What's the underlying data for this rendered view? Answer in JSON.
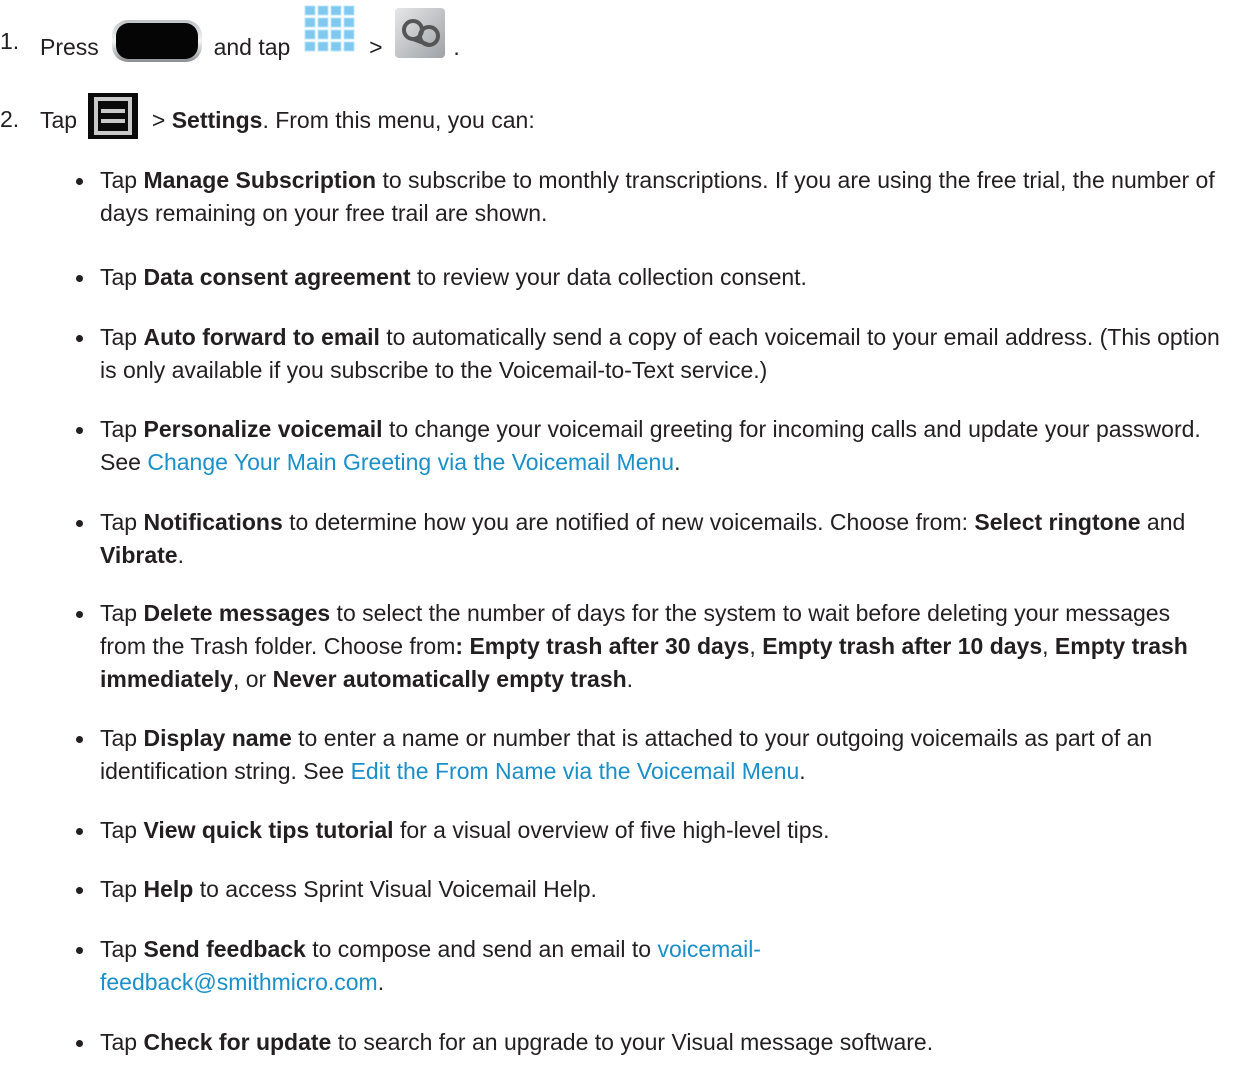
{
  "step1": {
    "number": "1.",
    "press": "Press",
    "and_tap": "and tap",
    "gt": ">",
    "period": ".",
    "icons": [
      "home-key-icon",
      "apps-grid-icon",
      "voicemail-icon"
    ]
  },
  "step2": {
    "number": "2.",
    "tap": "Tap",
    "gt": ">",
    "settings": "Settings",
    "rest": ". From this menu, you can:",
    "icons": [
      "menu-key-icon"
    ]
  },
  "bullets": [
    {
      "pre": "Tap ",
      "bold": "Manage Subscription",
      "post": " to subscribe to monthly transcriptions. If you are using the free trial, the number of days remaining on your free trail are shown."
    },
    {
      "pre": "Tap ",
      "bold": "Data consent agreement",
      "post": " to review your data collection consent."
    },
    {
      "pre": "Tap ",
      "bold": "Auto forward to email",
      "post": " to automatically send a copy of each voicemail to your email address. (This option is only available if you subscribe to the Voicemail-to-Text service.)"
    },
    {
      "pre": "Tap ",
      "bold": "Personalize voicemail",
      "post": " to change your voicemail greeting for incoming calls and update your password. See ",
      "link": "Change Your Main Greeting via the Voicemail Menu",
      "end": "."
    },
    {
      "pre": "Tap ",
      "bold": "Notifications",
      "post": " to determine how you are notified of new voicemails. Choose from: ",
      "bold2": "Select ringtone",
      "and": " and ",
      "bold3": "Vibrate",
      "end": "."
    },
    {
      "pre": "Tap ",
      "bold": "Delete messages",
      "post": " to select the number of days for the system to wait before deleting your messages from the Trash folder. Choose from",
      "colon": ":",
      "o1": " Empty trash after 30 days",
      "s1": ", ",
      "o2": "Empty trash after 10 days",
      "s2": ", ",
      "o3": "Empty trash immediately",
      "s3": ", or ",
      "o4": "Never automatically empty trash",
      "end": "."
    },
    {
      "pre": "Tap ",
      "bold": "Display name",
      "post": " to enter a name or number that is attached to your outgoing voicemails as part of an identification string. See ",
      "link": "Edit the From Name via the Voicemail Menu",
      "end": "."
    },
    {
      "pre": "Tap ",
      "bold": "View quick tips tutorial",
      "post": " for a visual overview of five high-level tips."
    },
    {
      "pre": "Tap ",
      "bold": "Help",
      "post": " to access Sprint Visual Voicemail Help."
    },
    {
      "pre": "Tap ",
      "bold": "Send feedback",
      "post": " to compose and send an email to ",
      "link_line1": "voicemail-",
      "link_line2": "feedback@smithmicro.com",
      "end": "."
    },
    {
      "pre": "Tap ",
      "bold": "Check for update",
      "post": " to search for an upgrade to your Visual message software."
    }
  ],
  "colors": {
    "text": "#231f20",
    "link": "#1a8fc9",
    "background": "#ffffff"
  }
}
